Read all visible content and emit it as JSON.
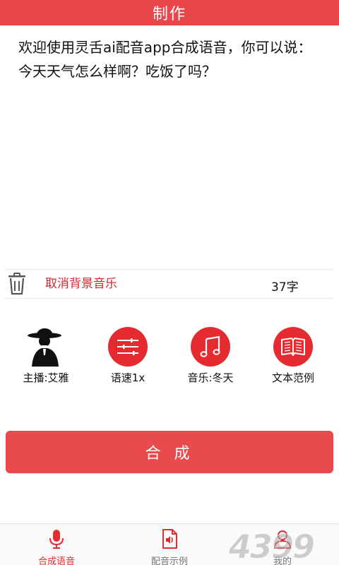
{
  "header": {
    "title": "制作"
  },
  "editor": {
    "text": "欢迎使用灵舌ai配音app合成语音，你可以说：今天天气怎么样啊？吃饭了吗？"
  },
  "toolbar": {
    "cancel_music_label": "取消背景音乐",
    "char_count": "37字"
  },
  "features": [
    {
      "label": "主播:艾雅",
      "icon": "narrator-avatar-icon"
    },
    {
      "label": "语速1x",
      "icon": "speed-sliders-icon"
    },
    {
      "label": "音乐:冬天",
      "icon": "music-note-icon"
    },
    {
      "label": "文本范例",
      "icon": "open-book-icon"
    }
  ],
  "actions": {
    "synthesize_label": "合 成"
  },
  "bottom_nav": [
    {
      "label": "合成语音",
      "icon": "microphone-icon",
      "active": true
    },
    {
      "label": "配音示例",
      "icon": "audio-file-icon",
      "active": false
    },
    {
      "label": "我的",
      "icon": "user-icon",
      "active": false
    }
  ],
  "colors": {
    "brand_red": "#e52b2f",
    "header_red": "#e8474a",
    "button_red": "#e84a4d"
  }
}
